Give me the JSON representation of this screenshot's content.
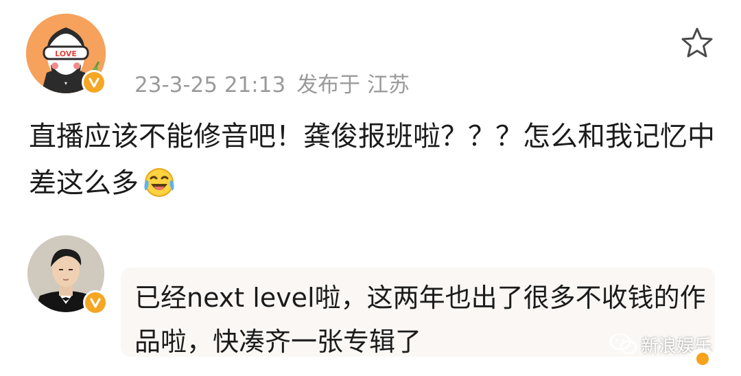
{
  "post": {
    "timestamp": "23-3-25 21:13",
    "location": "发布于 江苏",
    "text": "直播应该不能修音吧！龚俊报班啦？？？怎么和我记忆中差这么多",
    "emoji_icon": "laugh-cry-emoji",
    "star_icon": "star-outline-icon"
  },
  "reply": {
    "text": "已经next level啦，这两年也出了很多不收钱的作品啦，快凑齐一张专辑了"
  },
  "watermark": {
    "label": "新浪娱乐"
  },
  "colors": {
    "verified_badge": "#f5a623",
    "timestamp": "#9a9a9a",
    "reply_bubble": "#fbf7f5"
  }
}
